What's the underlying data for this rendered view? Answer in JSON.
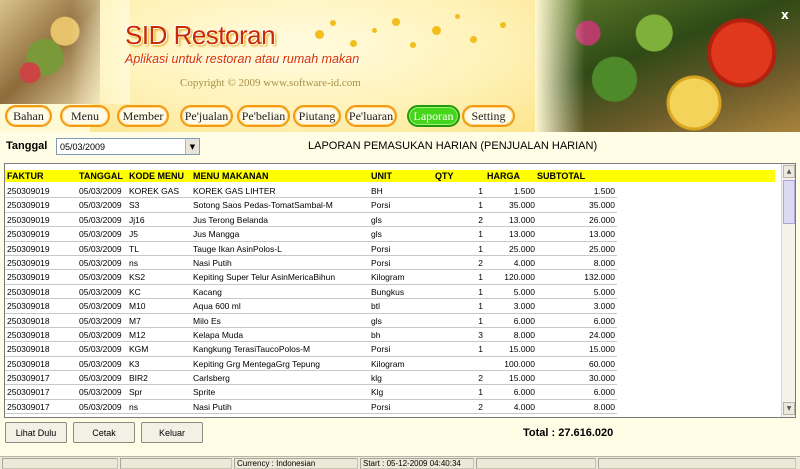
{
  "app": {
    "title": "SID Restoran",
    "subtitle": "Aplikasi untuk restoran atau rumah makan",
    "copyright": "Copyright © 2009 www.software-id.com",
    "close_glyph": "x"
  },
  "nav": [
    {
      "label": "Bahan"
    },
    {
      "label": "Menu"
    },
    {
      "label": "Member"
    },
    {
      "label": "Pe'jualan"
    },
    {
      "label": "Pe'belian"
    },
    {
      "label": "Piutang"
    },
    {
      "label": "Pe'luaran"
    },
    {
      "label": "Laporan",
      "active": true
    },
    {
      "label": "Setting"
    }
  ],
  "filter": {
    "label": "Tanggal",
    "date_value": "05/03/2009"
  },
  "report_title": "LAPORAN PEMASUKAN HARIAN (PENJUALAN HARIAN)",
  "table": {
    "headers": {
      "faktur": "FAKTUR",
      "tanggal": "TANGGAL",
      "kode": "KODE MENU",
      "menu": "MENU MAKANAN",
      "unit": "UNIT",
      "qty": "QTY",
      "harga": "HARGA",
      "subtotal": "SUBTOTAL"
    },
    "rows": [
      {
        "faktur": "250309019",
        "tanggal": "05/03/2009",
        "kode": "KOREK GAS",
        "menu": "KOREK GAS LIHTER",
        "unit": "BH",
        "qty": "1",
        "harga": "1.500",
        "subtotal": "1.500"
      },
      {
        "faktur": "250309019",
        "tanggal": "05/03/2009",
        "kode": "S3",
        "menu": "Sotong Saos Pedas-TomatSambal-M",
        "unit": "Porsi",
        "qty": "1",
        "harga": "35.000",
        "subtotal": "35.000"
      },
      {
        "faktur": "250309019",
        "tanggal": "05/03/2009",
        "kode": "Jj16",
        "menu": "Jus Terong Belanda",
        "unit": "gls",
        "qty": "2",
        "harga": "13.000",
        "subtotal": "26.000"
      },
      {
        "faktur": "250309019",
        "tanggal": "05/03/2009",
        "kode": "J5",
        "menu": "Jus Mangga",
        "unit": "gls",
        "qty": "1",
        "harga": "13.000",
        "subtotal": "13.000"
      },
      {
        "faktur": "250309019",
        "tanggal": "05/03/2009",
        "kode": "TL",
        "menu": "Tauge Ikan AsinPolos-L",
        "unit": "Porsi",
        "qty": "1",
        "harga": "25.000",
        "subtotal": "25.000"
      },
      {
        "faktur": "250309019",
        "tanggal": "05/03/2009",
        "kode": "ns",
        "menu": "Nasi Putih",
        "unit": "Porsi",
        "qty": "2",
        "harga": "4.000",
        "subtotal": "8.000"
      },
      {
        "faktur": "250309019",
        "tanggal": "05/03/2009",
        "kode": "KS2",
        "menu": "Kepiting Super Telur AsinMericaBihun",
        "unit": "Kilogram",
        "qty": "1",
        "harga": "120.000",
        "subtotal": "132.000"
      },
      {
        "faktur": "250309018",
        "tanggal": "05/03/2009",
        "kode": "KC",
        "menu": "Kacang",
        "unit": "Bungkus",
        "qty": "1",
        "harga": "5.000",
        "subtotal": "5.000"
      },
      {
        "faktur": "250309018",
        "tanggal": "05/03/2009",
        "kode": "M10",
        "menu": "Aqua 600 ml",
        "unit": "btl",
        "qty": "1",
        "harga": "3.000",
        "subtotal": "3.000"
      },
      {
        "faktur": "250309018",
        "tanggal": "05/03/2009",
        "kode": "M7",
        "menu": "Milo Es",
        "unit": "gls",
        "qty": "1",
        "harga": "6.000",
        "subtotal": "6.000"
      },
      {
        "faktur": "250309018",
        "tanggal": "05/03/2009",
        "kode": "M12",
        "menu": "Kelapa Muda",
        "unit": "bh",
        "qty": "3",
        "harga": "8.000",
        "subtotal": "24.000"
      },
      {
        "faktur": "250309018",
        "tanggal": "05/03/2009",
        "kode": "KGM",
        "menu": "Kangkung TerasiTaucoPolos-M",
        "unit": "Porsi",
        "qty": "1",
        "harga": "15.000",
        "subtotal": "15.000"
      },
      {
        "faktur": "250309018",
        "tanggal": "05/03/2009",
        "kode": "K3",
        "menu": "Kepiting Grg MentegaGrg Tepung",
        "unit": "Kilogram",
        "qty": "",
        "harga": "100.000",
        "subtotal": "60.000"
      },
      {
        "faktur": "250309017",
        "tanggal": "05/03/2009",
        "kode": "BIR2",
        "menu": "Carlsberg",
        "unit": "klg",
        "qty": "2",
        "harga": "15.000",
        "subtotal": "30.000"
      },
      {
        "faktur": "250309017",
        "tanggal": "05/03/2009",
        "kode": "Spr",
        "menu": "Sprite",
        "unit": "Klg",
        "qty": "1",
        "harga": "6.000",
        "subtotal": "6.000"
      },
      {
        "faktur": "250309017",
        "tanggal": "05/03/2009",
        "kode": "ns",
        "menu": "Nasi Putih",
        "unit": "Porsi",
        "qty": "2",
        "harga": "4.000",
        "subtotal": "8.000"
      }
    ]
  },
  "buttons": {
    "lihat": "Lihat Dulu",
    "cetak": "Cetak",
    "keluar": "Keluar"
  },
  "total": "Total : 27.616.020",
  "status": {
    "currency": "Currency : Indonesian",
    "start": "Start  : 05-12-2009 04:40:34"
  },
  "colors": {
    "header_yellow": "#ffff00",
    "active_tab": "#45d61c",
    "pill_border": "#f29a12",
    "title_red": "#c92a00"
  }
}
